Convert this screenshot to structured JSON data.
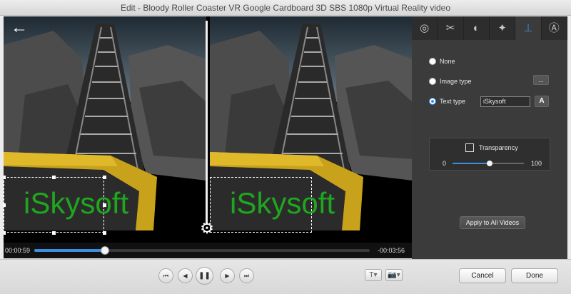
{
  "window": {
    "title": "Edit - Bloody Roller Coaster VR Google Cardboard 3D SBS 1080p Virtual Reality video"
  },
  "player": {
    "current_time": "00:00:59",
    "remaining_time": "-00:03:56",
    "progress_fraction": 0.21,
    "watermark_text": "iSkysoft",
    "watermark_color": "#1fa61f"
  },
  "panel": {
    "tabs": [
      {
        "icon": "3d-glasses-icon",
        "glyph": "◎"
      },
      {
        "icon": "crop-icon",
        "glyph": "✂"
      },
      {
        "icon": "adjust-icon",
        "glyph": "◐"
      },
      {
        "icon": "effects-icon",
        "glyph": "✦"
      },
      {
        "icon": "watermark-icon",
        "glyph": "⊥"
      },
      {
        "icon": "subtitle-icon",
        "glyph": "Ⓐ"
      }
    ],
    "active_tab": 4,
    "options": {
      "none_label": "None",
      "image_label": "Image type",
      "text_label": "Text type",
      "selected": "text"
    },
    "dots_label": "...",
    "text_value": "iSkysoft",
    "font_button_label": "A",
    "transparency": {
      "label": "Transparency",
      "min_label": "0",
      "max_label": "100",
      "value": 52
    },
    "apply_label": "Apply to All Videos"
  },
  "controls": {
    "prev_glyph": "⏮",
    "step_back_glyph": "◀",
    "pause_glyph": "❚❚",
    "step_fwd_glyph": "▶",
    "next_glyph": "⏭",
    "text_tool_glyph": "T▾",
    "snapshot_glyph": "📷▾",
    "cancel_label": "Cancel",
    "done_label": "Done"
  },
  "colors": {
    "accent": "#3c8fe0",
    "panel_bg": "#3b3b3b"
  }
}
